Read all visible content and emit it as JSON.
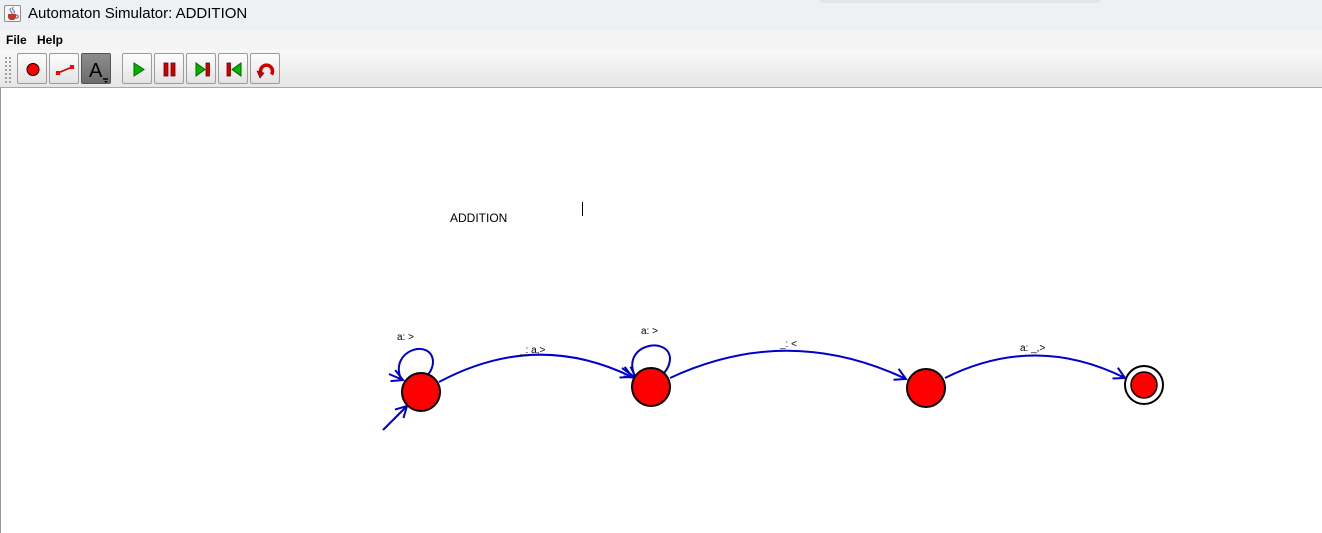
{
  "window": {
    "title": "Automaton Simulator: ADDITION",
    "icon": "java-cup-icon"
  },
  "menu": {
    "items": [
      "File",
      "Help"
    ]
  },
  "toolbar": {
    "buttons": [
      {
        "icon": "add-state-icon",
        "color": "#ff0000"
      },
      {
        "icon": "add-transition-icon",
        "color": "#ff0000"
      },
      {
        "icon": "add-text-icon",
        "active": true
      },
      {
        "icon": "play-icon",
        "color": "#00b400"
      },
      {
        "icon": "pause-icon",
        "color": "#d00000"
      },
      {
        "icon": "step-forward-icon",
        "color": "#00b400"
      },
      {
        "icon": "step-back-icon",
        "color": "#00b400"
      },
      {
        "icon": "reset-icon",
        "color": "#d00000"
      }
    ],
    "text_tool_glyph": "A"
  },
  "canvas": {
    "title_text": "ADDITION",
    "colors": {
      "state_fill": "#ff0000",
      "state_stroke": "#000000",
      "transition": "#0000cc"
    },
    "transition_labels": {
      "q0_loop": "a: >",
      "q0_q1": "_: a,>",
      "q1_loop": "a: >",
      "q1_q2": "_: <",
      "q2_q3": "a: _,>"
    }
  }
}
